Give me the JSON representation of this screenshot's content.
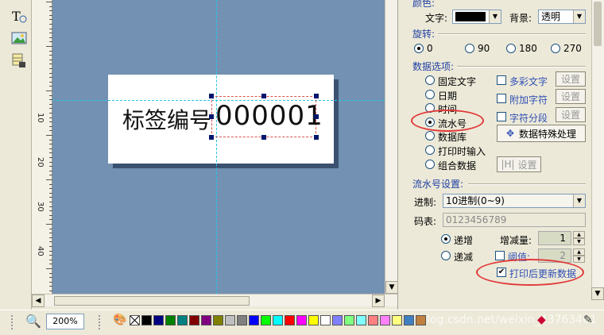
{
  "ruler": {
    "labels": [
      "10",
      "20",
      "30",
      "40"
    ]
  },
  "label": {
    "text": "标签编号",
    "serial": "000001"
  },
  "panel": {
    "color_section": "颜色:",
    "text_color_label": "文字:",
    "bg_label": "背景:",
    "bg_value": "透明",
    "rotate_section": "旋转:",
    "rotations": [
      "0",
      "90",
      "180",
      "270"
    ],
    "data_options_section": "数据选项:",
    "data_options": [
      "固定文字",
      "日期",
      "时间",
      "流水号",
      "数据库",
      "打印时输入",
      "组合数据"
    ],
    "extra_options": [
      "多彩文字",
      "附加字符",
      "字符分段"
    ],
    "settings_btn": "设置",
    "special_btn": "数据特殊处理",
    "serial_section": "流水号设置:",
    "base_label": "进制:",
    "base_value": "10进制(0~9)",
    "code_label": "码表:",
    "code_value": "0123456789",
    "inc_label": "递增",
    "dec_label": "递减",
    "step_label": "增减量:",
    "step_value": "1",
    "threshold_label": "阈值:",
    "threshold_value": "2",
    "update_after_print": "打印后更新数据"
  },
  "bottom": {
    "zoom": "200%",
    "watermark": "https://blog.csdn.net/weixin_43763401",
    "swatches": [
      "#000000",
      "#000080",
      "#008000",
      "#008080",
      "#800000",
      "#800080",
      "#808000",
      "#c0c0c0",
      "#808080",
      "#0000ff",
      "#00ff00",
      "#00ffff",
      "#ff0000",
      "#ff00ff",
      "#ffff00",
      "#ffffff",
      "#8080ff",
      "#80ff80",
      "#80ffff",
      "#ff8080",
      "#ff80ff",
      "#ffff80",
      "#4080c0",
      "#c08040"
    ]
  }
}
